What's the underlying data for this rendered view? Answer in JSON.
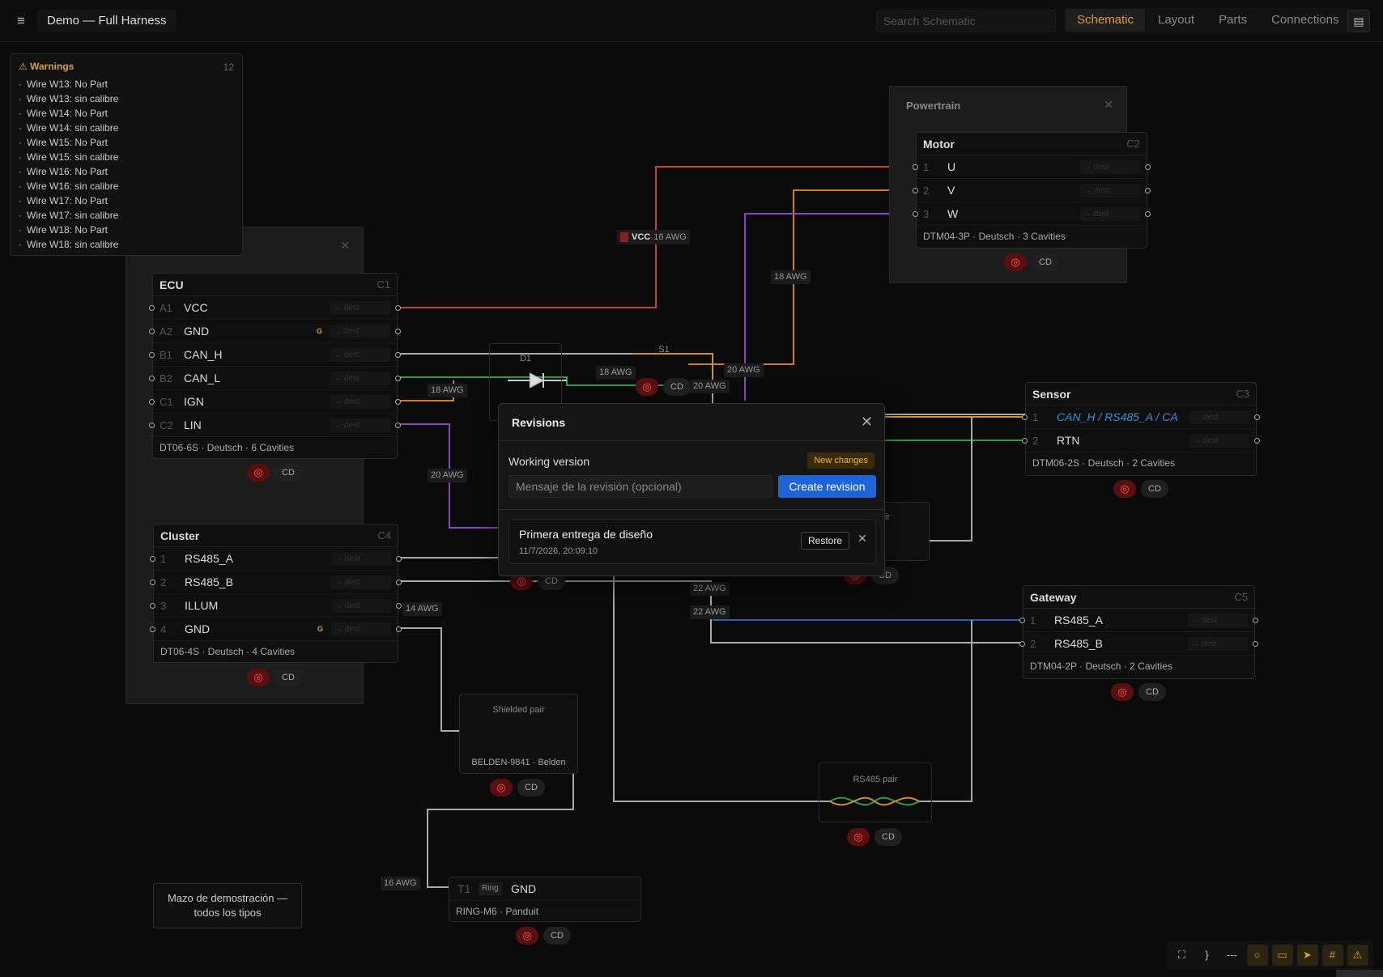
{
  "header": {
    "menu_icon": "hamburger-icon",
    "title": "Demo — Full Harness",
    "search_placeholder": "Search Schematic",
    "tabs": [
      "Schematic",
      "Layout",
      "Parts",
      "Connections"
    ],
    "active_tab": "Schematic",
    "panel_icon": "panel-icon"
  },
  "warnings": {
    "title": "Warnings",
    "count": "12",
    "items": [
      "Wire W13: No Part",
      "Wire W13: sin calibre",
      "Wire W14: No Part",
      "Wire W14: sin calibre",
      "Wire W15: No Part",
      "Wire W15: sin calibre",
      "Wire W16: No Part",
      "Wire W16: sin calibre",
      "Wire W17: No Part",
      "Wire W17: sin calibre",
      "Wire W18: No Part",
      "Wire W18: sin calibre"
    ]
  },
  "groups": {
    "powertrain": "Powertrain"
  },
  "connectors": {
    "ecu": {
      "name": "ECU",
      "id": "C1",
      "footer": "DT06-6S · Deutsch · 6 Cavities",
      "pins": [
        {
          "no": "A1",
          "name": "VCC"
        },
        {
          "no": "A2",
          "name": "GND",
          "g": "G"
        },
        {
          "no": "B1",
          "name": "CAN_H"
        },
        {
          "no": "B2",
          "name": "CAN_L"
        },
        {
          "no": "C1",
          "name": "IGN"
        },
        {
          "no": "C2",
          "name": "LIN"
        }
      ]
    },
    "cluster": {
      "name": "Cluster",
      "id": "C4",
      "footer": "DT06-4S · Deutsch · 4 Cavities",
      "pins": [
        {
          "no": "1",
          "name": "RS485_A"
        },
        {
          "no": "2",
          "name": "RS485_B"
        },
        {
          "no": "3",
          "name": "ILLUM"
        },
        {
          "no": "4",
          "name": "GND",
          "g": "G"
        }
      ]
    },
    "motor": {
      "name": "Motor",
      "id": "C2",
      "footer": "DTM04-3P · Deutsch · 3 Cavities",
      "pins": [
        {
          "no": "1",
          "name": "U"
        },
        {
          "no": "2",
          "name": "V"
        },
        {
          "no": "3",
          "name": "W"
        }
      ]
    },
    "sensor": {
      "name": "Sensor",
      "id": "C3",
      "footer": "DTM06-2S · Deutsch · 2 Cavities",
      "pins": [
        {
          "no": "1",
          "name": "CAN_H / RS485_A / CA"
        },
        {
          "no": "2",
          "name": "RTN"
        }
      ]
    },
    "gateway": {
      "name": "Gateway",
      "id": "C5",
      "footer": "DTM04-2P · Deutsch · 2 Cavities",
      "pins": [
        {
          "no": "1",
          "name": "RS485_A"
        },
        {
          "no": "2",
          "name": "RS485_B"
        }
      ]
    },
    "dest_placeholder": "→ dest"
  },
  "components": {
    "diode": "D1",
    "splice": "S1",
    "vcc_label": "VCC",
    "shielded_pair": {
      "title": "Shielded pair",
      "footer": "BELDEN-9841 · Belden"
    },
    "rs485_pair": {
      "title": "RS485 pair"
    },
    "partial_pair": "ir",
    "terminal": {
      "no": "T1",
      "kind": "Ring",
      "name": "GND",
      "footer": "RING-M6 · Panduit"
    }
  },
  "badges": {
    "cd": "CD"
  },
  "awg_labels": {
    "a16": "16 AWG",
    "a18": "18 AWG",
    "a20": "20 AWG",
    "a22": "22 AWG",
    "a14": "14 AWG"
  },
  "note": "Mazo de demostración — todos los tipos",
  "toolbar": [
    "fit-icon",
    "brace-icon",
    "dash-icon",
    "circle-icon",
    "rect-icon",
    "arrow-icon",
    "hash-icon",
    "warning-icon"
  ],
  "modal": {
    "title": "Revisions",
    "working_version": "Working version",
    "new_changes": "New changes",
    "message_placeholder": "Mensaje de la revisión (opcional)",
    "create_button": "Create revision",
    "revisions": [
      {
        "name": "Primera entrega de diseño",
        "date": "11/7/2026, 20:09:10"
      }
    ],
    "restore_button": "Restore"
  }
}
